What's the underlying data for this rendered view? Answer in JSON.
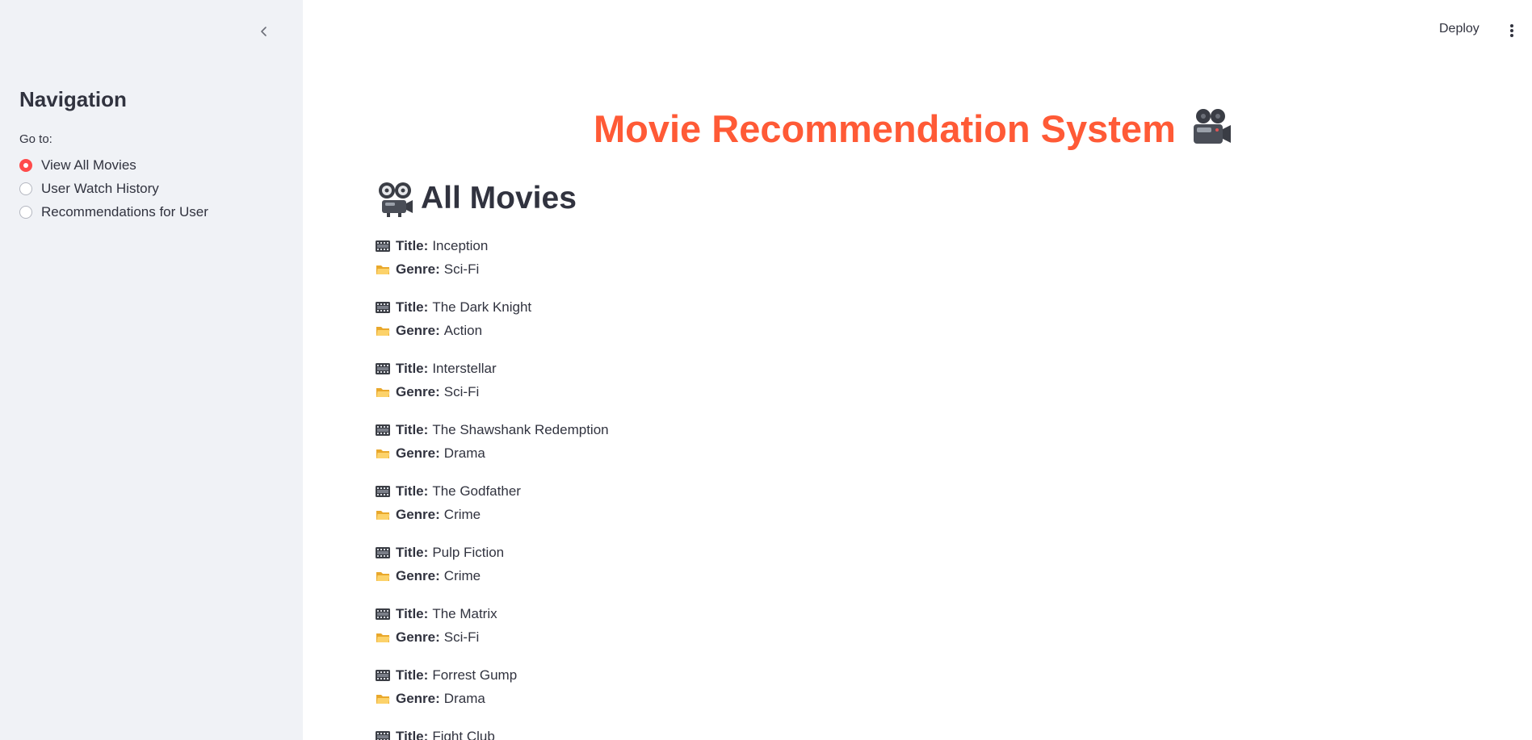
{
  "sidebar": {
    "collapse_icon": "chevron-left-icon",
    "title": "Navigation",
    "radio_label": "Go to:",
    "options": [
      {
        "label": "View All Movies",
        "selected": true
      },
      {
        "label": "User Watch History",
        "selected": false
      },
      {
        "label": "Recommendations for User",
        "selected": false
      }
    ]
  },
  "toolbar": {
    "deploy_label": "Deploy",
    "menu_icon": "kebab-menu-icon"
  },
  "main": {
    "title": "Movie Recommendation System",
    "title_icon": "movie-camera-icon",
    "section_title": "All Movies",
    "section_icon": "film-projector-icon",
    "title_key": "Title:",
    "genre_key": "Genre:",
    "movies": [
      {
        "title": "Inception",
        "genre": "Sci-Fi"
      },
      {
        "title": "The Dark Knight",
        "genre": "Action"
      },
      {
        "title": "Interstellar",
        "genre": "Sci-Fi"
      },
      {
        "title": "The Shawshank Redemption",
        "genre": "Drama"
      },
      {
        "title": "The Godfather",
        "genre": "Crime"
      },
      {
        "title": "Pulp Fiction",
        "genre": "Crime"
      },
      {
        "title": "The Matrix",
        "genre": "Sci-Fi"
      },
      {
        "title": "Forrest Gump",
        "genre": "Drama"
      },
      {
        "title": "Fight Club",
        "genre": ""
      }
    ]
  },
  "colors": {
    "accent": "#ff4b4b",
    "title": "#ff5a36",
    "sidebar_bg": "#f0f2f6",
    "text": "#31333f"
  }
}
